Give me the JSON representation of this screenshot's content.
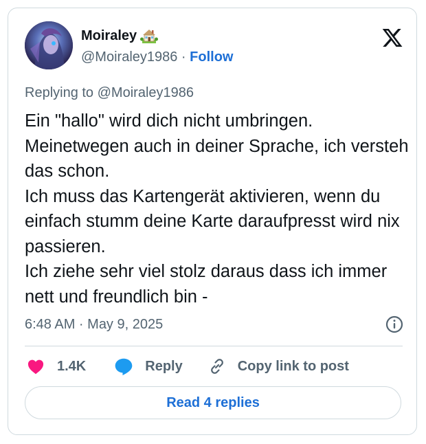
{
  "author": {
    "display_name": "Moiraley",
    "name_emoji": "house-with-garden-icon",
    "handle": "@Moiraley1986",
    "separator": " · ",
    "follow_label": "Follow"
  },
  "platform": {
    "logo": "x-logo-icon"
  },
  "reply_context": {
    "prefix": "Replying to ",
    "mention": "@Moiraley1986"
  },
  "tweet": {
    "text": "Ein \"hallo\" wird dich nicht umbringen.\nMeinetwegen auch in deiner Sprache, ich versteh das schon.\nIch muss das Kartengerät aktivieren, wenn du einfach stumm deine Karte daraufpresst wird nix passieren.\nIch ziehe sehr viel stolz daraus dass ich immer nett und freundlich bin -",
    "timestamp": "6:48 AM · May 9, 2025"
  },
  "actions": {
    "like_count": "1.4K",
    "reply_label": "Reply",
    "copy_label": "Copy link to post"
  },
  "read_replies_label": "Read 4 replies",
  "colors": {
    "accent": "#1d6fd6",
    "heart": "#f91880",
    "reply_bubble": "#1d9bf0",
    "muted": "#536471",
    "text": "#0f1419",
    "border": "#cfd9de"
  }
}
